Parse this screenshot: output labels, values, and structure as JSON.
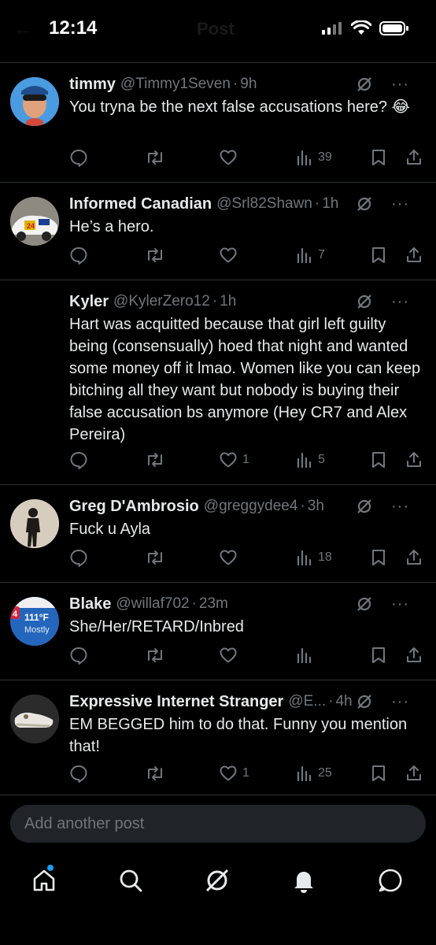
{
  "status_bar": {
    "time": "12:14",
    "ghost_title": "Post"
  },
  "posts": [
    {
      "name": "timmy",
      "handle": "@Timmy1Seven",
      "ago": "9h",
      "text": "You tryna be the next false accusations here? 😂",
      "likes": "",
      "views": "39"
    },
    {
      "name": "Informed Canadian",
      "handle": "@Srl82Shawn",
      "ago": "1h",
      "text": "He’s a hero.",
      "likes": "",
      "views": "7"
    },
    {
      "name": "Kyler",
      "handle": "@KylerZero12",
      "ago": "1h",
      "text": "Hart was acquitted because that girl left guilty being (consensually) hoed that night and wanted some money off it lmao. Women like you can keep bitching all they want but nobody is buying their false accusation bs anymore (Hey CR7 and Alex Pereira)",
      "likes": "1",
      "views": "5"
    },
    {
      "name": "Greg D'Ambrosio",
      "handle": "@greggydee4",
      "ago": "3h",
      "text": "Fuck u Ayla",
      "likes": "",
      "views": "18"
    },
    {
      "name": "Blake",
      "handle": "@willaf702",
      "ago": "23m",
      "text": "She/Her/RETARD/Inbred",
      "likes": "",
      "views": "",
      "avatar_text": {
        "temp": "111°F",
        "cond": "Mostly",
        "badge": "4"
      }
    },
    {
      "name": "Expressive Internet Stranger",
      "handle": "@E...",
      "ago": "4h",
      "text": "EM BEGGED him to do that. Funny you mention that!",
      "likes": "1",
      "views": "25"
    }
  ],
  "compose": {
    "placeholder": "Add another post"
  },
  "icons": {
    "reply": "reply-icon",
    "repost": "repost-icon",
    "like": "like-icon",
    "views": "views-icon",
    "bookmark": "bookmark-icon",
    "share": "share-icon",
    "grok": "grok-icon",
    "more": "more-icon"
  },
  "tabs": [
    "home",
    "search",
    "grok",
    "notifications",
    "messages"
  ],
  "colors": {
    "background": "#000000",
    "text": "#e7e9ea",
    "muted": "#71767b",
    "divider": "#2f3336",
    "accent": "#1d9bf0"
  }
}
